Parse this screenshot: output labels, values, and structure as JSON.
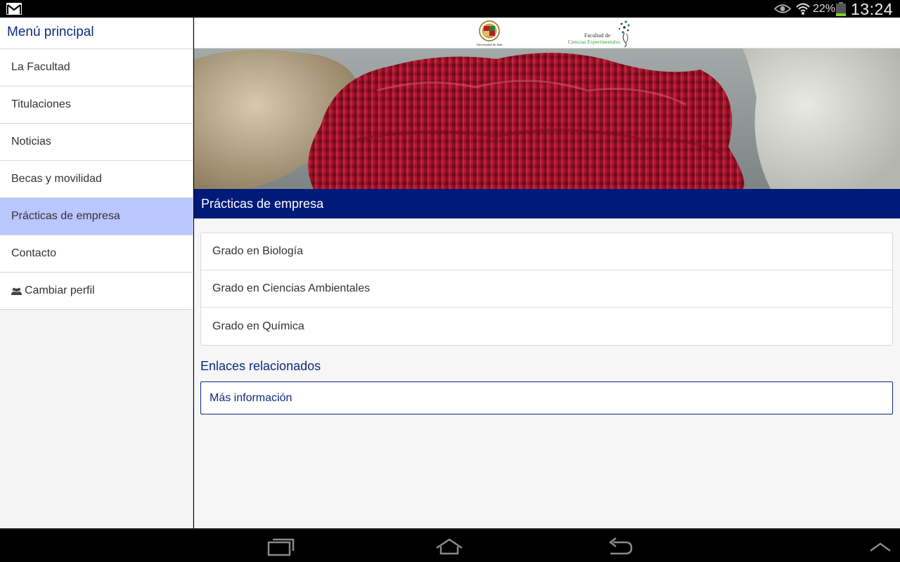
{
  "status_bar": {
    "battery_percent": "22%",
    "clock": "13:24",
    "battery_level": 0.22,
    "icons": [
      "gmail-icon",
      "eye-icon",
      "wifi-icon",
      "battery-icon"
    ]
  },
  "sidebar": {
    "title": "Menú principal",
    "items": [
      {
        "label": "La Facultad",
        "active": false
      },
      {
        "label": "Titulaciones",
        "active": false
      },
      {
        "label": "Noticias",
        "active": false
      },
      {
        "label": "Becas y movilidad",
        "active": false
      },
      {
        "label": "Prácticas de empresa",
        "active": true
      },
      {
        "label": "Contacto",
        "active": false
      },
      {
        "label": "Cambiar perfil",
        "active": false,
        "icon": "people-icon"
      }
    ]
  },
  "header": {
    "uja_logo_text": "Universidad de Jaén",
    "faculty_logo_line1": "Facultad de",
    "faculty_logo_line2": "Ciencias Experimentales"
  },
  "main": {
    "section_title": "Prácticas de empresa",
    "degrees": [
      {
        "label": "Grado en Biología"
      },
      {
        "label": "Grado en Ciencias Ambientales"
      },
      {
        "label": "Grado en Química"
      }
    ],
    "links_title": "Enlaces relacionados",
    "more_info": "Más información"
  },
  "colors": {
    "brand_blue": "#001a7a",
    "title_blue": "#0d2a80",
    "active_item": "#b9c6ff",
    "coral_red": "#b3132c"
  },
  "nav_bar": {
    "buttons": [
      "recent-apps-icon",
      "home-icon",
      "back-icon",
      "chevron-up-icon"
    ]
  }
}
